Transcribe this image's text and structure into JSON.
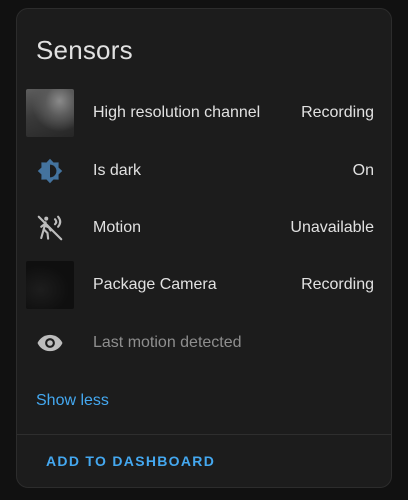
{
  "card": {
    "title": "Sensors",
    "show_less_label": "Show less",
    "add_button_label": "ADD TO DASHBOARD"
  },
  "entities": [
    {
      "name": "High resolution channel",
      "state": "Recording",
      "icon": "camera-thumbnail"
    },
    {
      "name": "Is dark",
      "state": "On",
      "icon": "brightness-icon",
      "icon_color": "#44739e"
    },
    {
      "name": "Motion",
      "state": "Unavailable",
      "icon": "motion-sensor-off-icon"
    },
    {
      "name": "Package Camera",
      "state": "Recording",
      "icon": "camera-thumbnail"
    },
    {
      "name": "Last motion detected",
      "state": "",
      "icon": "eye-icon"
    }
  ],
  "colors": {
    "accent": "#44a8f0",
    "card_background": "#1c1c1c",
    "text": "#e1e1e1",
    "text_secondary": "#8e8e8e"
  }
}
